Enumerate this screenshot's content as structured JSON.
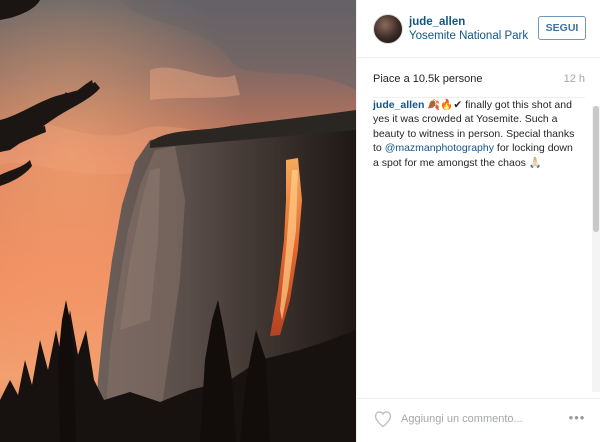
{
  "post": {
    "photo_alt": "photo",
    "header": {
      "username": "jude_allen",
      "location": "Yosemite National Park",
      "follow_label": "SEGUI"
    },
    "likes_text": "Piace a 10.5k persone",
    "timestamp": "12 h",
    "caption": {
      "username": "jude_allen",
      "text_part1": " 🍂🔥✔ finally got this shot and yes it was crowded at Yosemite. Such a beauty to witness in person. Special thanks to ",
      "mention": "@mazmanphotography",
      "text_part2": " for locking down a spot for me amongst the chaos 🙏🏻"
    },
    "footer": {
      "comment_placeholder": "Aggiungi un commento...",
      "like_icon": "heart-icon",
      "more_icon": "more-options-icon"
    }
  },
  "colors": {
    "link_blue": "#125688",
    "follow_border": "#6f97b6",
    "muted_gray": "#a5a7aa"
  }
}
